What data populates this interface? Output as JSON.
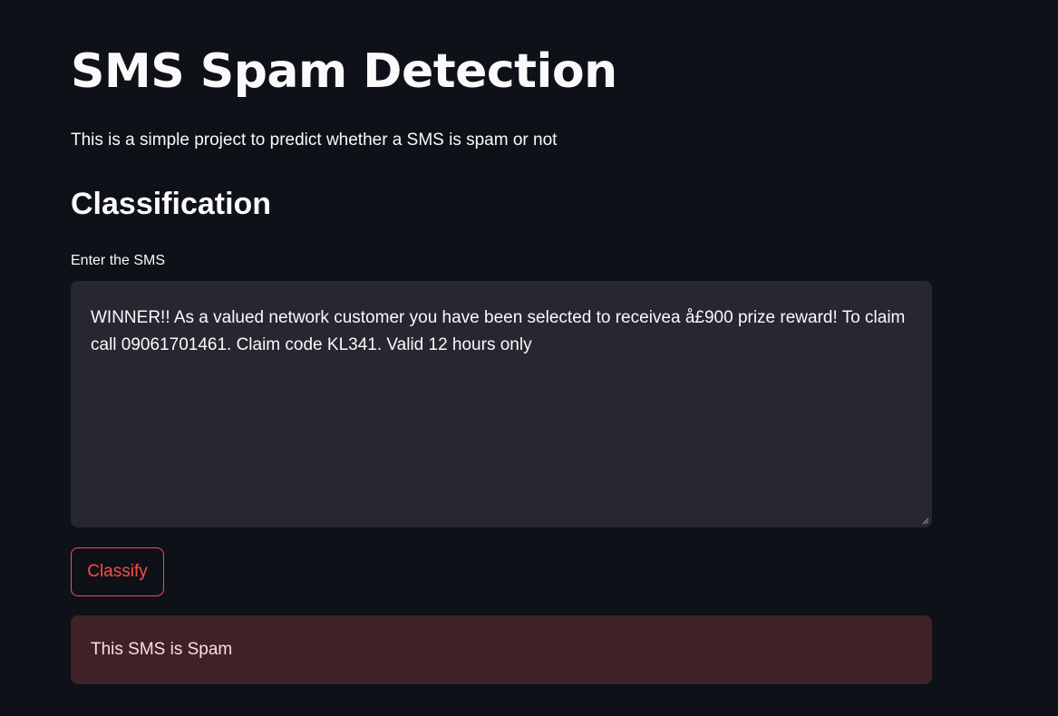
{
  "header": {
    "title": "SMS Spam Detection",
    "subtitle": "This is a simple project to predict whether a SMS is spam or not"
  },
  "classification": {
    "heading": "Classification",
    "input_label": "Enter the SMS",
    "input_value": "WINNER!! As a valued network customer you have been selected to receivea å£900 prize reward! To claim call 09061701461. Claim code KL341. Valid 12 hours only",
    "button_label": "Classify",
    "result_text": "This SMS is Spam"
  },
  "colors": {
    "background": "#0e1117",
    "input_background": "#262730",
    "accent": "#ff4b4b",
    "error_background": "#3e2227"
  },
  "icons": {
    "resize": "resize-handle-icon"
  }
}
